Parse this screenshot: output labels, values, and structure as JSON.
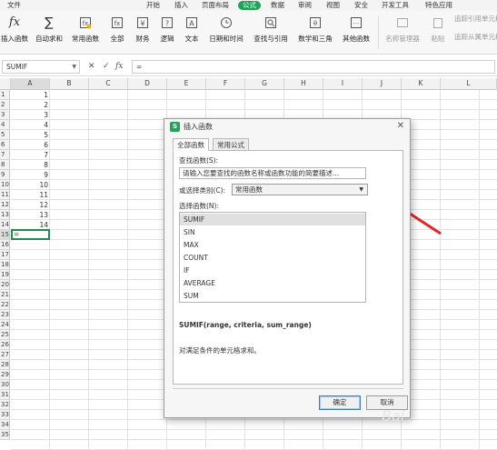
{
  "menu": {
    "file": "文件",
    "items": [
      "开始",
      "插入",
      "页面布局",
      "公式",
      "数据",
      "审阅",
      "视图",
      "安全",
      "开发工具",
      "特色应用"
    ],
    "active_index": 3
  },
  "ribbon": {
    "buttons": [
      "插入函数",
      "自动求和",
      "常用函数",
      "全部",
      "财务",
      "逻辑",
      "文本",
      "日期和时间",
      "查找与引用",
      "数学和三角",
      "其他函数"
    ],
    "disabled": [
      "名称管理器",
      "粘贴"
    ],
    "right": [
      "追踪引用单元格",
      "追踪从属单元格"
    ]
  },
  "formula_bar": {
    "name_box": "SUMIF",
    "cancel": "✕",
    "confirm": "✓",
    "fx": "fx",
    "content": "="
  },
  "sheet": {
    "columns": [
      "A",
      "B",
      "C",
      "D",
      "E",
      "F",
      "G",
      "H",
      "I",
      "J",
      "K",
      "L"
    ],
    "rows": [
      "1",
      "2",
      "3",
      "4",
      "5",
      "6",
      "7",
      "8",
      "9",
      "10",
      "11",
      "12",
      "13",
      "14",
      "15",
      "16",
      "17",
      "18",
      "19",
      "20",
      "21",
      "22",
      "23",
      "24",
      "25",
      "26",
      "27",
      "28",
      "29",
      "30",
      "31",
      "32",
      "33",
      "34",
      "35"
    ],
    "a_values": [
      "1",
      "2",
      "3",
      "4",
      "5",
      "6",
      "7",
      "8",
      "9",
      "10",
      "11",
      "12",
      "13",
      "14"
    ],
    "active_cell": "=",
    "active_row": "15"
  },
  "dialog": {
    "title": "插入函数",
    "close": "✕",
    "tabs": [
      "全部函数",
      "常用公式"
    ],
    "search_label": "查找函数(S):",
    "search_placeholder": "请输入您要查找的函数名称或函数功能的简要描述...",
    "category_label": "或选择类别(C):",
    "category_value": "常用函数",
    "select_label": "选择函数(N):",
    "functions": [
      "SUMIF",
      "SIN",
      "MAX",
      "COUNT",
      "IF",
      "AVERAGE",
      "SUM"
    ],
    "selected_function": "SUMIF",
    "signature": "SUMIF(range, criteria, sum_range)",
    "description": "对满足条件的单元格求和。",
    "ok": "确定",
    "cancel": "取消"
  },
  "colors": {
    "accent": "#22a35a",
    "arrow": "#e8232a"
  }
}
